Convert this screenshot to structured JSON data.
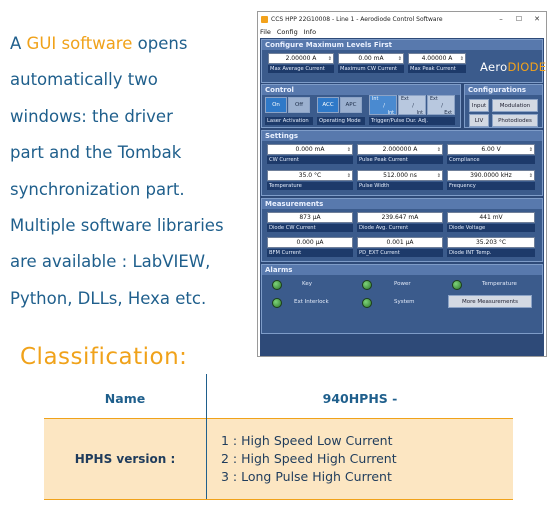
{
  "intro": {
    "l1a": "A ",
    "l1b": "GUI software",
    "l1c": " opens",
    "l2": "automatically two",
    "l3": "windows: the driver",
    "l4": "part and the Tombak",
    "l5": "synchronization part.",
    "l6": "Multiple software libraries",
    "l7": "are available : LabVIEW,",
    "l8": "Python, DLLs, Hexa etc."
  },
  "window": {
    "title": "CCS HPP 22G10008 - Line 1 - Aerodiode Control Software",
    "menu": [
      "File",
      "Config",
      "Info"
    ],
    "controls": [
      "–",
      "☐",
      "✕"
    ]
  },
  "config_max": {
    "header": "Configure Maximum Levels First",
    "fields": [
      {
        "value": "2.00000 A",
        "label": "Max Average Current"
      },
      {
        "value": "0.00 mA",
        "label": "Maximum CW Current"
      },
      {
        "value": "4.00000 A",
        "label": "Max Peak Current"
      }
    ],
    "logo_a": "Aero",
    "logo_b": "DIODE"
  },
  "control": {
    "header": "Control",
    "on": "On",
    "off": "Off",
    "acc": "ACC",
    "apc": "APC",
    "int1a": "Int",
    "int1b": "Ext",
    "int1c": "Int",
    "int2a": "Ext",
    "int2b": "Int",
    "int3a": "Ext",
    "int3b": "Ext",
    "laser_activation": "Laser Activation",
    "operating_mode": "Operating Mode",
    "trigger": "Trigger/Pulse Dur. Adj."
  },
  "configurations": {
    "header": "Configurations",
    "input": "Input",
    "modulation": "Modulation",
    "liv": "LIV",
    "photodiodes": "Photodiodes"
  },
  "settings": {
    "header": "Settings",
    "fields": [
      {
        "value": "0.000 mA",
        "label": "CW Current"
      },
      {
        "value": "2.000000 A",
        "label": "Pulse Peak Current"
      },
      {
        "value": "6.00 V",
        "label": "Compliance"
      },
      {
        "value": "35.0 °C",
        "label": "Temperature"
      },
      {
        "value": "512.000 ns",
        "label": "Pulse Width"
      },
      {
        "value": "390.0000 kHz",
        "label": "Frequency"
      }
    ]
  },
  "measurements": {
    "header": "Measurements",
    "fields": [
      {
        "value": "873 µA",
        "label": "Diode CW Current"
      },
      {
        "value": "239.647 mA",
        "label": "Diode Avg. Current"
      },
      {
        "value": "441 mV",
        "label": "Diode Voltage"
      },
      {
        "value": "0.000 µA",
        "label": "BFM Current"
      },
      {
        "value": "0.001 µA",
        "label": "PD_EXT Current"
      },
      {
        "value": "35.203 °C",
        "label": "Diode INT Temp."
      }
    ]
  },
  "alarms": {
    "header": "Alarms",
    "key": "Key",
    "power": "Power",
    "temperature": "Temperature",
    "ext_interlock": "Ext Interlock",
    "system": "System",
    "more": "More Measurements"
  },
  "classification": {
    "title": "Classification:",
    "name_header": "Name",
    "code_header": "940HPHS -",
    "row_label": "HPHS version :",
    "options": [
      "1 : High Speed Low Current",
      "2 : High Speed High Current",
      "3 : Long Pulse High Current"
    ]
  },
  "colors": {
    "accent": "#f0a21a",
    "text_blue": "#1f5f8c",
    "panel_blue": "#2e4a78",
    "row_bg": "#fce6c2"
  }
}
